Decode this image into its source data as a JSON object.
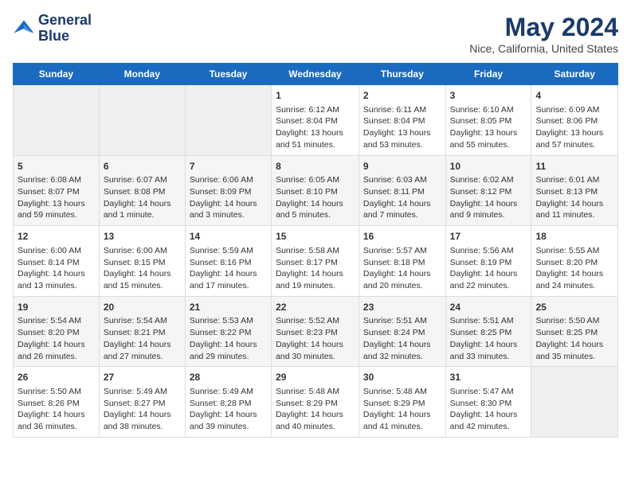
{
  "header": {
    "logo_line1": "General",
    "logo_line2": "Blue",
    "title": "May 2024",
    "subtitle": "Nice, California, United States"
  },
  "days_of_week": [
    "Sunday",
    "Monday",
    "Tuesday",
    "Wednesday",
    "Thursday",
    "Friday",
    "Saturday"
  ],
  "weeks": [
    [
      {
        "day": "",
        "content": ""
      },
      {
        "day": "",
        "content": ""
      },
      {
        "day": "",
        "content": ""
      },
      {
        "day": "1",
        "content": "Sunrise: 6:12 AM\nSunset: 8:04 PM\nDaylight: 13 hours\nand 51 minutes."
      },
      {
        "day": "2",
        "content": "Sunrise: 6:11 AM\nSunset: 8:04 PM\nDaylight: 13 hours\nand 53 minutes."
      },
      {
        "day": "3",
        "content": "Sunrise: 6:10 AM\nSunset: 8:05 PM\nDaylight: 13 hours\nand 55 minutes."
      },
      {
        "day": "4",
        "content": "Sunrise: 6:09 AM\nSunset: 8:06 PM\nDaylight: 13 hours\nand 57 minutes."
      }
    ],
    [
      {
        "day": "5",
        "content": "Sunrise: 6:08 AM\nSunset: 8:07 PM\nDaylight: 13 hours\nand 59 minutes."
      },
      {
        "day": "6",
        "content": "Sunrise: 6:07 AM\nSunset: 8:08 PM\nDaylight: 14 hours\nand 1 minute."
      },
      {
        "day": "7",
        "content": "Sunrise: 6:06 AM\nSunset: 8:09 PM\nDaylight: 14 hours\nand 3 minutes."
      },
      {
        "day": "8",
        "content": "Sunrise: 6:05 AM\nSunset: 8:10 PM\nDaylight: 14 hours\nand 5 minutes."
      },
      {
        "day": "9",
        "content": "Sunrise: 6:03 AM\nSunset: 8:11 PM\nDaylight: 14 hours\nand 7 minutes."
      },
      {
        "day": "10",
        "content": "Sunrise: 6:02 AM\nSunset: 8:12 PM\nDaylight: 14 hours\nand 9 minutes."
      },
      {
        "day": "11",
        "content": "Sunrise: 6:01 AM\nSunset: 8:13 PM\nDaylight: 14 hours\nand 11 minutes."
      }
    ],
    [
      {
        "day": "12",
        "content": "Sunrise: 6:00 AM\nSunset: 8:14 PM\nDaylight: 14 hours\nand 13 minutes."
      },
      {
        "day": "13",
        "content": "Sunrise: 6:00 AM\nSunset: 8:15 PM\nDaylight: 14 hours\nand 15 minutes."
      },
      {
        "day": "14",
        "content": "Sunrise: 5:59 AM\nSunset: 8:16 PM\nDaylight: 14 hours\nand 17 minutes."
      },
      {
        "day": "15",
        "content": "Sunrise: 5:58 AM\nSunset: 8:17 PM\nDaylight: 14 hours\nand 19 minutes."
      },
      {
        "day": "16",
        "content": "Sunrise: 5:57 AM\nSunset: 8:18 PM\nDaylight: 14 hours\nand 20 minutes."
      },
      {
        "day": "17",
        "content": "Sunrise: 5:56 AM\nSunset: 8:19 PM\nDaylight: 14 hours\nand 22 minutes."
      },
      {
        "day": "18",
        "content": "Sunrise: 5:55 AM\nSunset: 8:20 PM\nDaylight: 14 hours\nand 24 minutes."
      }
    ],
    [
      {
        "day": "19",
        "content": "Sunrise: 5:54 AM\nSunset: 8:20 PM\nDaylight: 14 hours\nand 26 minutes."
      },
      {
        "day": "20",
        "content": "Sunrise: 5:54 AM\nSunset: 8:21 PM\nDaylight: 14 hours\nand 27 minutes."
      },
      {
        "day": "21",
        "content": "Sunrise: 5:53 AM\nSunset: 8:22 PM\nDaylight: 14 hours\nand 29 minutes."
      },
      {
        "day": "22",
        "content": "Sunrise: 5:52 AM\nSunset: 8:23 PM\nDaylight: 14 hours\nand 30 minutes."
      },
      {
        "day": "23",
        "content": "Sunrise: 5:51 AM\nSunset: 8:24 PM\nDaylight: 14 hours\nand 32 minutes."
      },
      {
        "day": "24",
        "content": "Sunrise: 5:51 AM\nSunset: 8:25 PM\nDaylight: 14 hours\nand 33 minutes."
      },
      {
        "day": "25",
        "content": "Sunrise: 5:50 AM\nSunset: 8:25 PM\nDaylight: 14 hours\nand 35 minutes."
      }
    ],
    [
      {
        "day": "26",
        "content": "Sunrise: 5:50 AM\nSunset: 8:26 PM\nDaylight: 14 hours\nand 36 minutes."
      },
      {
        "day": "27",
        "content": "Sunrise: 5:49 AM\nSunset: 8:27 PM\nDaylight: 14 hours\nand 38 minutes."
      },
      {
        "day": "28",
        "content": "Sunrise: 5:49 AM\nSunset: 8:28 PM\nDaylight: 14 hours\nand 39 minutes."
      },
      {
        "day": "29",
        "content": "Sunrise: 5:48 AM\nSunset: 8:29 PM\nDaylight: 14 hours\nand 40 minutes."
      },
      {
        "day": "30",
        "content": "Sunrise: 5:48 AM\nSunset: 8:29 PM\nDaylight: 14 hours\nand 41 minutes."
      },
      {
        "day": "31",
        "content": "Sunrise: 5:47 AM\nSunset: 8:30 PM\nDaylight: 14 hours\nand 42 minutes."
      },
      {
        "day": "",
        "content": ""
      }
    ]
  ]
}
